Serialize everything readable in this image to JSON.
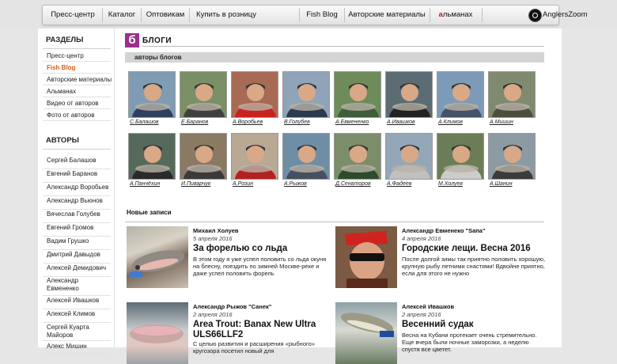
{
  "nav": {
    "items": [
      "Пресс-центр",
      "Каталог",
      "Оптовикам",
      "Купить в розницу",
      "Fish Blog",
      "Авторские материалы"
    ],
    "almanac_first": "а",
    "almanac_rest": "льманах",
    "anglerszoom": "AnglersZoom"
  },
  "sidebar": {
    "sections_title": "РАЗДЕЛЫ",
    "sections": [
      "Пресс-центр",
      "Fish Blog",
      "Авторские материалы",
      "Альманах",
      "Видео от авторов",
      "Фото от авторов"
    ],
    "authors_title": "АВТОРЫ",
    "authors": [
      "Сергей Балашов",
      "Евгений Баранов",
      "Александр Воробьев",
      "Александр Вьюнов",
      "Вячеслав Голубев",
      "Евгений Громов",
      "Вадим Грушко",
      "Дмитрий Давыдов",
      "Алексей Демидович",
      "Александр Евмененко",
      "Алексей Ивашков",
      "Алексей Климов",
      "Сергей Куарта Майоров",
      "Алекс Мишин"
    ]
  },
  "main": {
    "logo_letter": "б",
    "title": "БЛОГИ",
    "section": "авторы блогов",
    "thumbs_row1": [
      "С.Балашов",
      "Е.Баранов",
      "А.Воробьев",
      "В.Голубев",
      "А.Евмененко",
      "А.Ивашков",
      "А.Климов",
      "А.Мишин"
    ],
    "thumbs_row2": [
      "А.Панчёхин",
      "И.Пиварчук",
      "А.Розин",
      "А.Рыжов",
      "Д.Сенаторов",
      "А.Фадеев",
      "М.Холуев",
      "А.Шанин"
    ],
    "new_posts_title": "Новые записи",
    "posts": [
      {
        "author": "Михаил Холуев",
        "date": "5 апреля 2016",
        "title": "За форелью со льда",
        "text": "В этом году я уже успел половить со льда окуня на блесну, поездить по зимней Москве-реке и даже успел половить форель"
      },
      {
        "author": "Александр Евменеко \"Sапа\"",
        "date": "4 апреля 2016",
        "title": "Городские лещи. Весна 2016",
        "text": "После долгой зимы так приятно половить хорошую, крупную рыбу летними снастями! Вдвойне приятно, если для этого не нужно"
      },
      {
        "author": "Александр Рыжов \"Санек\"",
        "date": "2 апреля 2016",
        "title": "Area Trout: Banax New Ultra ULS66LLF2",
        "text": "С целью развития и расширения «рыбного» кругозора посетил новый для"
      },
      {
        "author": "Алексей Ивашков",
        "date": "2 апреля 2016",
        "title": "Весенний судак",
        "text": "Весна на Кубани протекает очень стремительно. Еще вчера были ночные заморозки, а неделю спустя все цветет."
      }
    ]
  },
  "colors": {
    "accent_orange": "#e15a12",
    "almanac_red": "#c4161c",
    "blog_purple": "#9b2f8f"
  }
}
